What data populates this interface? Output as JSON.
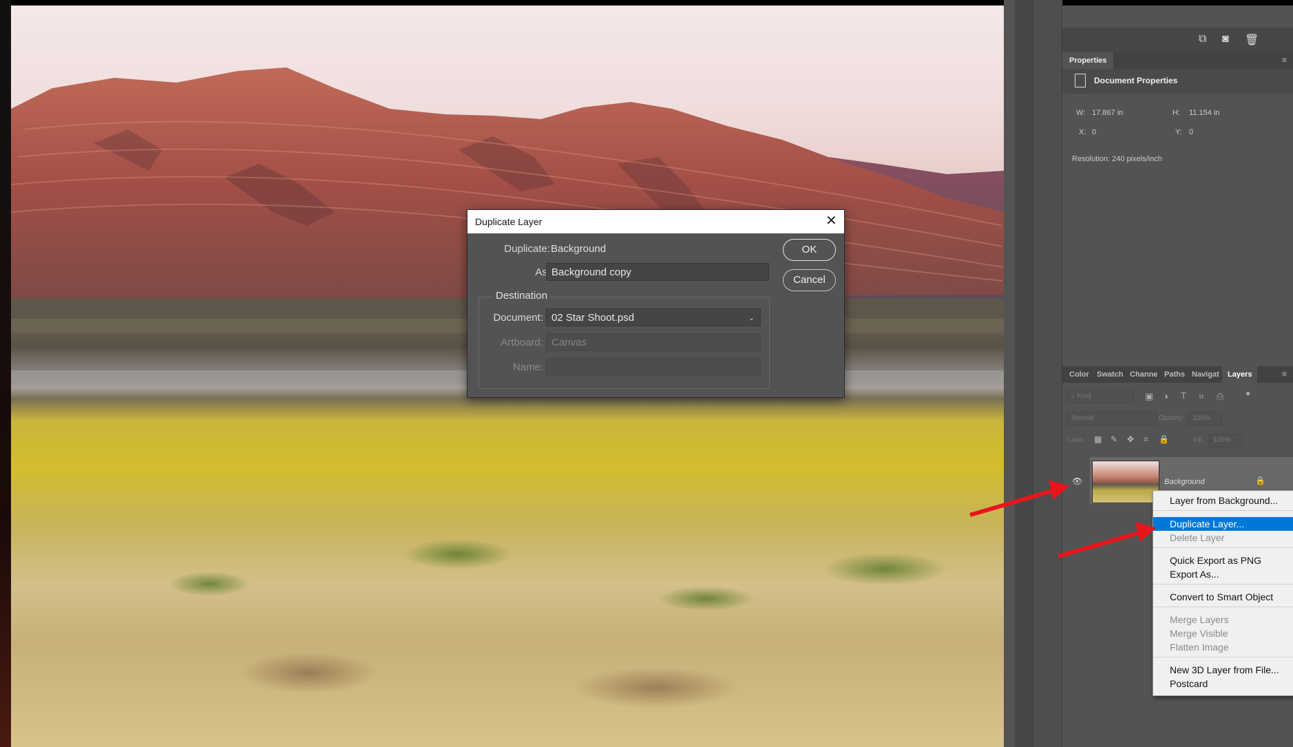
{
  "dialog": {
    "title": "Duplicate Layer",
    "duplicate_label": "Duplicate:",
    "duplicate_value": "Background",
    "as_label": "As:",
    "as_value": "Background copy",
    "destination_label": "Destination",
    "document_label": "Document:",
    "document_value": "02 Star Shoot.psd",
    "artboard_label": "Artboard:",
    "artboard_value": "Canvas",
    "name_label": "Name:",
    "name_value": "",
    "ok_label": "OK",
    "cancel_label": "Cancel"
  },
  "properties": {
    "tab_label": "Properties",
    "header": "Document Properties",
    "w_label": "W:",
    "w_value": "17.867 in",
    "h_label": "H:",
    "h_value": "11.154 in",
    "x_label": "X:",
    "x_value": "0",
    "y_label": "Y:",
    "y_value": "0",
    "resolution": "Resolution: 240 pixels/inch"
  },
  "layers_panel": {
    "tabs": [
      "Color",
      "Swatch",
      "Channe",
      "Paths",
      "Navigat",
      "Layers"
    ],
    "active_tab": "Layers",
    "kind_label": "Kind",
    "blend_mode": "Normal",
    "opacity_label": "Opacity:",
    "opacity_value": "100%",
    "lock_label": "Lock:",
    "fill_label": "Fill:",
    "fill_value": "100%",
    "layer_name": "Background"
  },
  "context_menu": {
    "items": [
      {
        "label": "Layer from Background...",
        "enabled": true
      },
      {
        "label": "Duplicate Layer...",
        "enabled": true,
        "highlighted": true
      },
      {
        "label": "Delete Layer",
        "enabled": false
      },
      {
        "label": "Quick Export as PNG",
        "enabled": true
      },
      {
        "label": "Export As...",
        "enabled": true
      },
      {
        "label": "Convert to Smart Object",
        "enabled": true
      },
      {
        "label": "Merge Layers",
        "enabled": false
      },
      {
        "label": "Merge Visible",
        "enabled": false
      },
      {
        "label": "Flatten Image",
        "enabled": false
      },
      {
        "label": "New 3D Layer from File...",
        "enabled": true
      },
      {
        "label": "Postcard",
        "enabled": true
      }
    ]
  },
  "colors": {
    "highlight": "#0078d7",
    "arrow": "#e8161b",
    "panel_bg": "#535353"
  },
  "icons": [
    "new-layer-icon",
    "camera-icon",
    "trash-icon",
    "panel-menu-icon",
    "document-icon",
    "eye-icon",
    "lock-icon",
    "close-icon",
    "chevron-down-icon",
    "search-icon",
    "image-filter-icon",
    "adjustment-filter-icon",
    "type-filter-icon",
    "shape-filter-icon",
    "smart-filter-icon"
  ]
}
